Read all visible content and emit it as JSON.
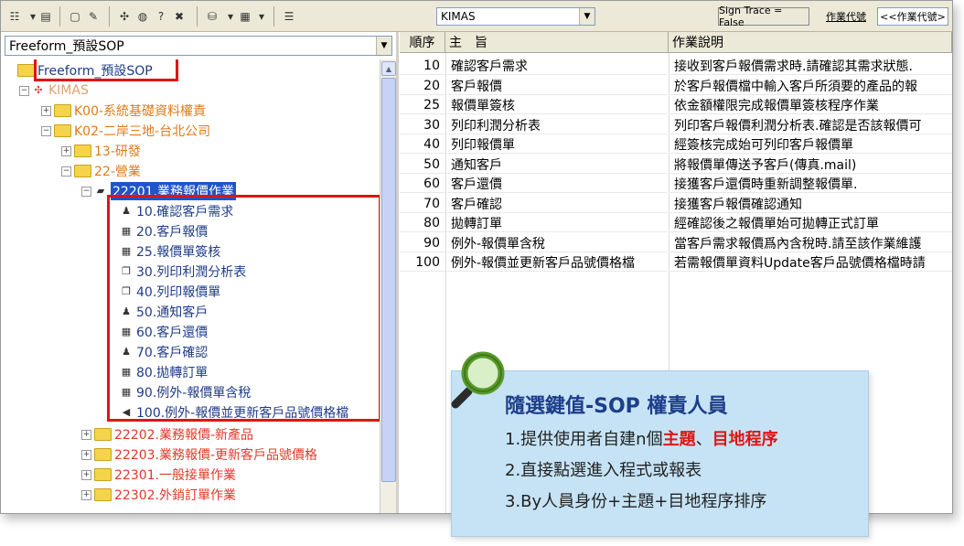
{
  "toolbar": {
    "system_select": "KIMAS",
    "sign_trace_button": "Sign Trace = False",
    "op_code_label": "作業代號",
    "op_code_button": "<<作業代號>"
  },
  "left_panel": {
    "profile_select": "Freeform_預設SOP",
    "tree": [
      {
        "label": "Freeform_預設SOP"
      },
      {
        "label": "KIMAS"
      },
      {
        "label": "K00-系統基礎資料權責"
      },
      {
        "label": "K02-二岸三地-台北公司"
      },
      {
        "label": "13-研發"
      },
      {
        "label": "22-營業"
      },
      {
        "label": "22201.業務報價作業"
      },
      {
        "label": "10.確認客戶需求"
      },
      {
        "label": "20.客戶報價"
      },
      {
        "label": "25.報價單簽核"
      },
      {
        "label": "30.列印利潤分析表"
      },
      {
        "label": "40.列印報價單"
      },
      {
        "label": "50.通知客戶"
      },
      {
        "label": "60.客戶還價"
      },
      {
        "label": "70.客戶確認"
      },
      {
        "label": "80.拋轉訂單"
      },
      {
        "label": "90.例外-報價單含稅"
      },
      {
        "label": "100.例外-報價並更新客戶品號價格檔"
      },
      {
        "label": "22202.業務報價-新產品"
      },
      {
        "label": "22203.業務報價-更新客戶品號價格"
      },
      {
        "label": "22301.一般接單作業"
      },
      {
        "label": "22302.外銷訂單作業"
      }
    ]
  },
  "grid": {
    "headers": [
      "順序",
      "主　旨",
      "作業說明"
    ],
    "rows": [
      {
        "seq": "10",
        "subject": "確認客戶需求",
        "desc": "接收到客戶報價需求時.請確認其需求狀態."
      },
      {
        "seq": "20",
        "subject": "客戶報價",
        "desc": "於客戶報價檔中輸入客戶所須要的產品的報"
      },
      {
        "seq": "25",
        "subject": "報價單簽核",
        "desc": "依金額權限完成報價單簽核程序作業"
      },
      {
        "seq": "30",
        "subject": "列印利潤分析表",
        "desc": "列印客戶報價利潤分析表.確認是否該報價可"
      },
      {
        "seq": "40",
        "subject": "列印報價單",
        "desc": "經簽核完成始可列印客戶報價單"
      },
      {
        "seq": "50",
        "subject": "通知客戶",
        "desc": "將報價單傳送予客戶(傳真.mail)"
      },
      {
        "seq": "60",
        "subject": "客戶還價",
        "desc": "接獲客戶還價時重新調整報價單."
      },
      {
        "seq": "70",
        "subject": "客戶確認",
        "desc": "接獲客戶報價確認通知"
      },
      {
        "seq": "80",
        "subject": "拋轉訂單",
        "desc": "經確認後之報價單始可拋轉正式訂單"
      },
      {
        "seq": "90",
        "subject": "例外-報價單含稅",
        "desc": "當客戶需求報價爲內含稅時.請至該作業維護"
      },
      {
        "seq": "100",
        "subject": "例外-報價並更新客戶品號價格檔",
        "desc": "若需報價單資料Update客戶品號價格檔時請"
      }
    ]
  },
  "callout": {
    "title": "隨選鍵值-SOP 權責人員",
    "line1_pre": "1.提供使用者自建n個",
    "line1_hl1": "主題",
    "line1_mid": "、",
    "line1_hl2": "目地程序",
    "line2": "2.直接點選進入程式或報表",
    "line3": "3.By人員身份+主題+目地程序排序"
  }
}
